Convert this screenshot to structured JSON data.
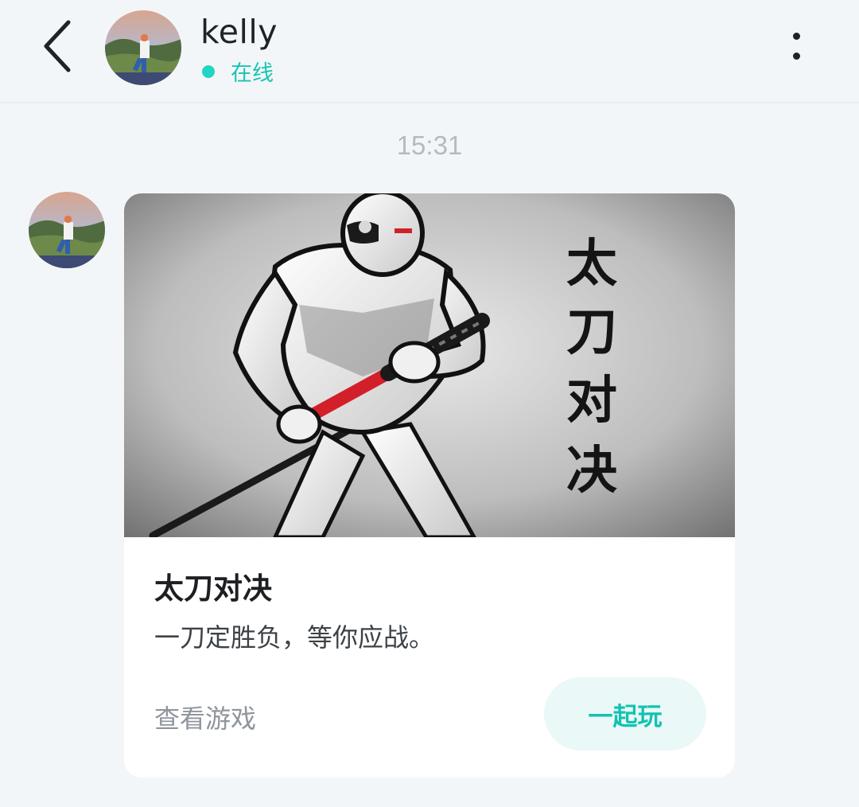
{
  "header": {
    "back_icon": "chevron-left-icon",
    "contact_name": "kelly",
    "status": "在线",
    "status_color": "#21d5c3",
    "more_icon": "more-vertical-icon"
  },
  "chat": {
    "timestamp": "15:31",
    "card": {
      "image_calligraphy": [
        "太",
        "刀",
        "对",
        "决"
      ],
      "title": "太刀对决",
      "description": "一刀定胜负，等你应战。",
      "view_game_label": "查看游戏",
      "play_button_label": "一起玩",
      "accent_color": "#13c2b1"
    }
  }
}
